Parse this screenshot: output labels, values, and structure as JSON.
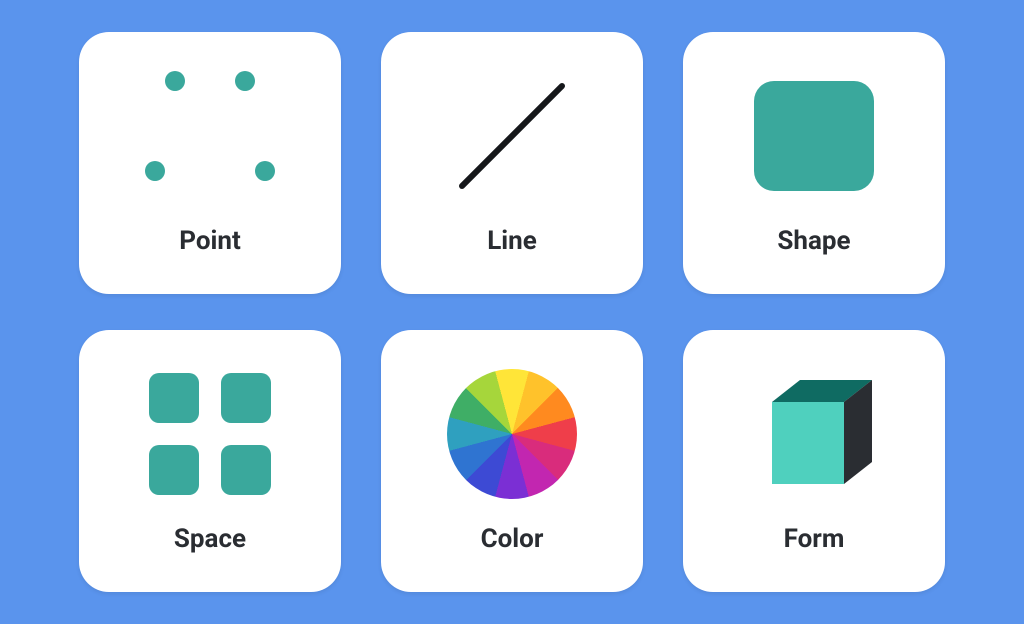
{
  "theme": {
    "background": "#5a94ed",
    "card_bg": "#ffffff",
    "accent": "#3aa89c",
    "text": "#2a2d32"
  },
  "cards": [
    {
      "label": "Point",
      "icon": "point-dots-icon"
    },
    {
      "label": "Line",
      "icon": "line-icon"
    },
    {
      "label": "Shape",
      "icon": "shape-icon"
    },
    {
      "label": "Space",
      "icon": "space-icon"
    },
    {
      "label": "Color",
      "icon": "color-wheel-icon"
    },
    {
      "label": "Form",
      "icon": "cube-icon"
    }
  ]
}
